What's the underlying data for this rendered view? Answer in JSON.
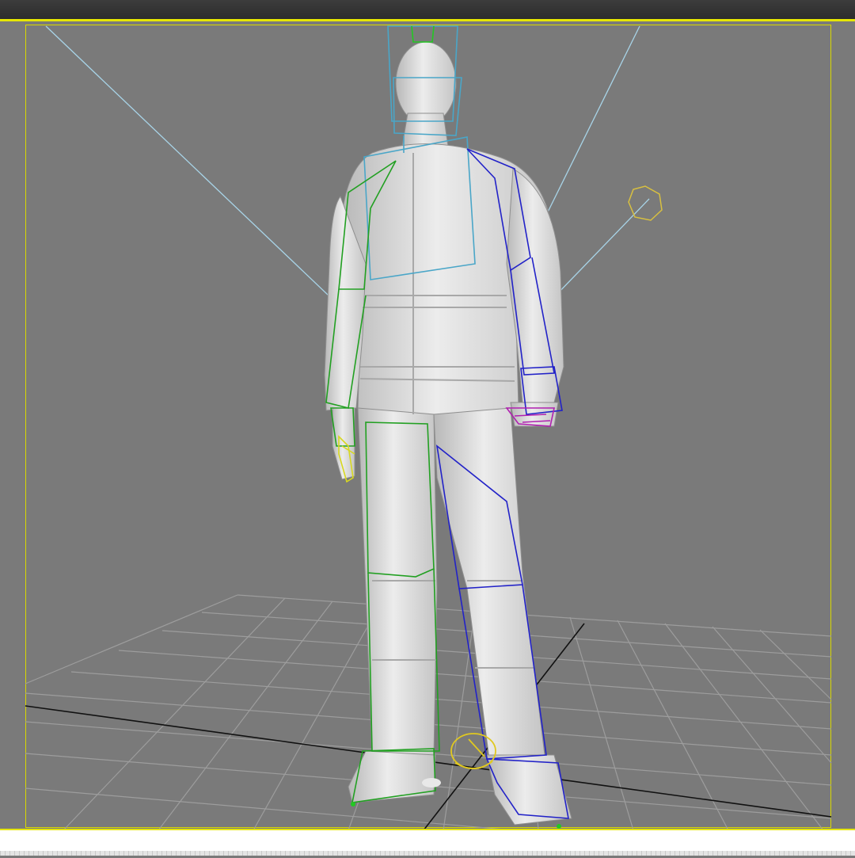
{
  "app": {
    "viewport_label": "",
    "colors": {
      "viewport_bg": "#7a7a7a",
      "active_border": "#e6e600",
      "grid": "#9d9d9d",
      "axis": "#111111",
      "camera_line": "#a8d4e8",
      "left_limb_bones": "#22a022",
      "right_limb_bones": "#2222c8",
      "spine_bones": "#4aa6c8",
      "right_hand_bones": "#b020b0",
      "left_hand_bones": "#d8d820",
      "mesh": "#d9d9d9"
    }
  },
  "scene": {
    "icons": [
      "light-helper-icon",
      "root-footprint-helper-icon"
    ]
  }
}
